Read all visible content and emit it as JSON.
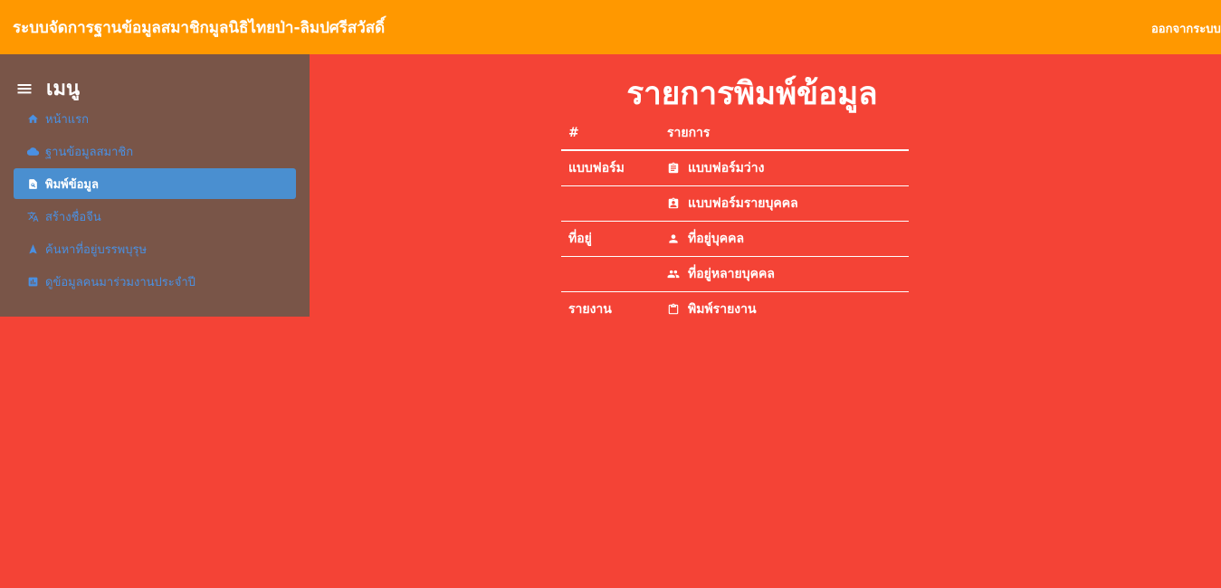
{
  "header": {
    "title": "ระบบจัดการฐานข้อมูลสมาชิกมูลนิธิไทยป่า-ลิมปศรีสวัสดิ์",
    "logout_label": "ออกจากระบบ",
    "bg_color": "#ff9800"
  },
  "sidebar": {
    "menu_title": "เมนู",
    "bg_color": "#795548",
    "items": [
      {
        "label": "หน้าแรก",
        "icon": "home-icon"
      },
      {
        "label": "ฐานข้อมูลสมาชิก",
        "icon": "cloud-icon"
      },
      {
        "label": "พิมพ์ข้อมูล",
        "icon": "document-search-icon",
        "active": true
      },
      {
        "label": "สร้างชื่อจีน",
        "icon": "translate-icon"
      },
      {
        "label": "ค้นหาที่อยู่บรรพบุรุษ",
        "icon": "navigation-arrow-icon"
      },
      {
        "label": "ดูข้อมูลคนมาร่วมงานประจำปี",
        "icon": "stats-chart-icon"
      }
    ]
  },
  "main": {
    "title": "รายการพิมพ์ข้อมูล",
    "bg_color": "#f44336",
    "table": {
      "headers": [
        "#",
        "รายการ"
      ],
      "rows": [
        {
          "category": "แบบฟอร์ม",
          "item": "แบบฟอร์มว่าง",
          "icon": "assignment-icon"
        },
        {
          "category": "",
          "item": "แบบฟอร์มรายบุคคล",
          "icon": "assignment-ind-icon"
        },
        {
          "category": "ที่อยู่",
          "item": "ที่อยู่บุคคล",
          "icon": "person-icon"
        },
        {
          "category": "",
          "item": "ที่อยู่หลายบุคคล",
          "icon": "people-icon"
        },
        {
          "category": "รายงาน",
          "item": "พิมพ์รายงาน",
          "icon": "clipboard-icon"
        }
      ]
    }
  }
}
